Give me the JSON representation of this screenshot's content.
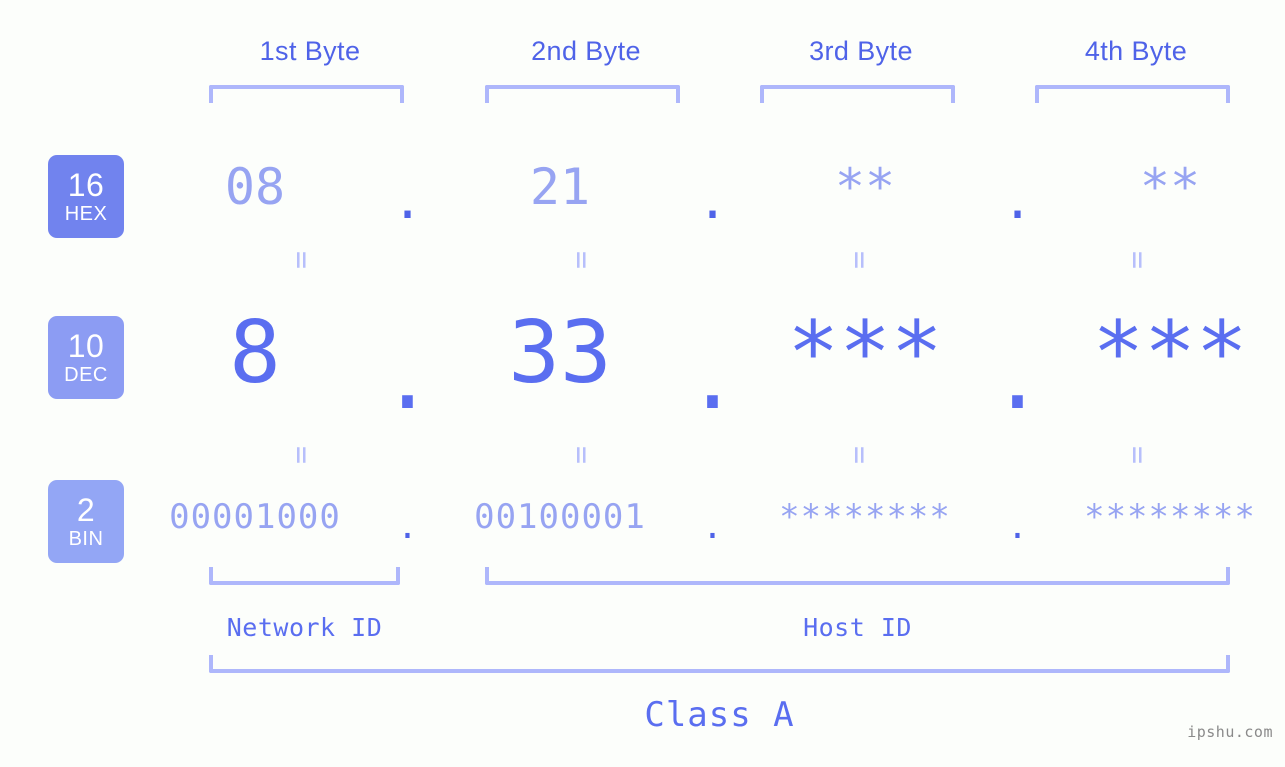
{
  "background_color": "#fcfefb",
  "accent_colors": {
    "strong_blue": "#4f63e8",
    "medium_blue": "#5a6ef0",
    "light_blue": "#97a4f2",
    "pale_blue": "#aeb7fb",
    "badge_hex": "#7183ee",
    "badge_dec": "#8c9cf3",
    "badge_bin": "#93a6f5"
  },
  "byte_headers": [
    {
      "label": "1st Byte"
    },
    {
      "label": "2nd Byte"
    },
    {
      "label": "3rd Byte"
    },
    {
      "label": "4th Byte"
    }
  ],
  "radix_badges": [
    {
      "number": "16",
      "tag": "HEX"
    },
    {
      "number": "10",
      "tag": "DEC"
    },
    {
      "number": "2",
      "tag": "BIN"
    }
  ],
  "rows": {
    "hex": {
      "values": [
        "08",
        "21",
        "**",
        "**"
      ],
      "separators": [
        ".",
        ".",
        "."
      ]
    },
    "dec": {
      "values": [
        "8",
        "33",
        "***",
        "***"
      ],
      "separators": [
        ".",
        ".",
        "."
      ]
    },
    "bin": {
      "values": [
        "00001000",
        "00100001",
        "********",
        "********"
      ],
      "separators": [
        ".",
        ".",
        "."
      ]
    }
  },
  "equals_marker": "=",
  "segments": {
    "network_id": "Network ID",
    "host_id": "Host ID",
    "class": "Class A"
  },
  "watermark": "ipshu.com"
}
